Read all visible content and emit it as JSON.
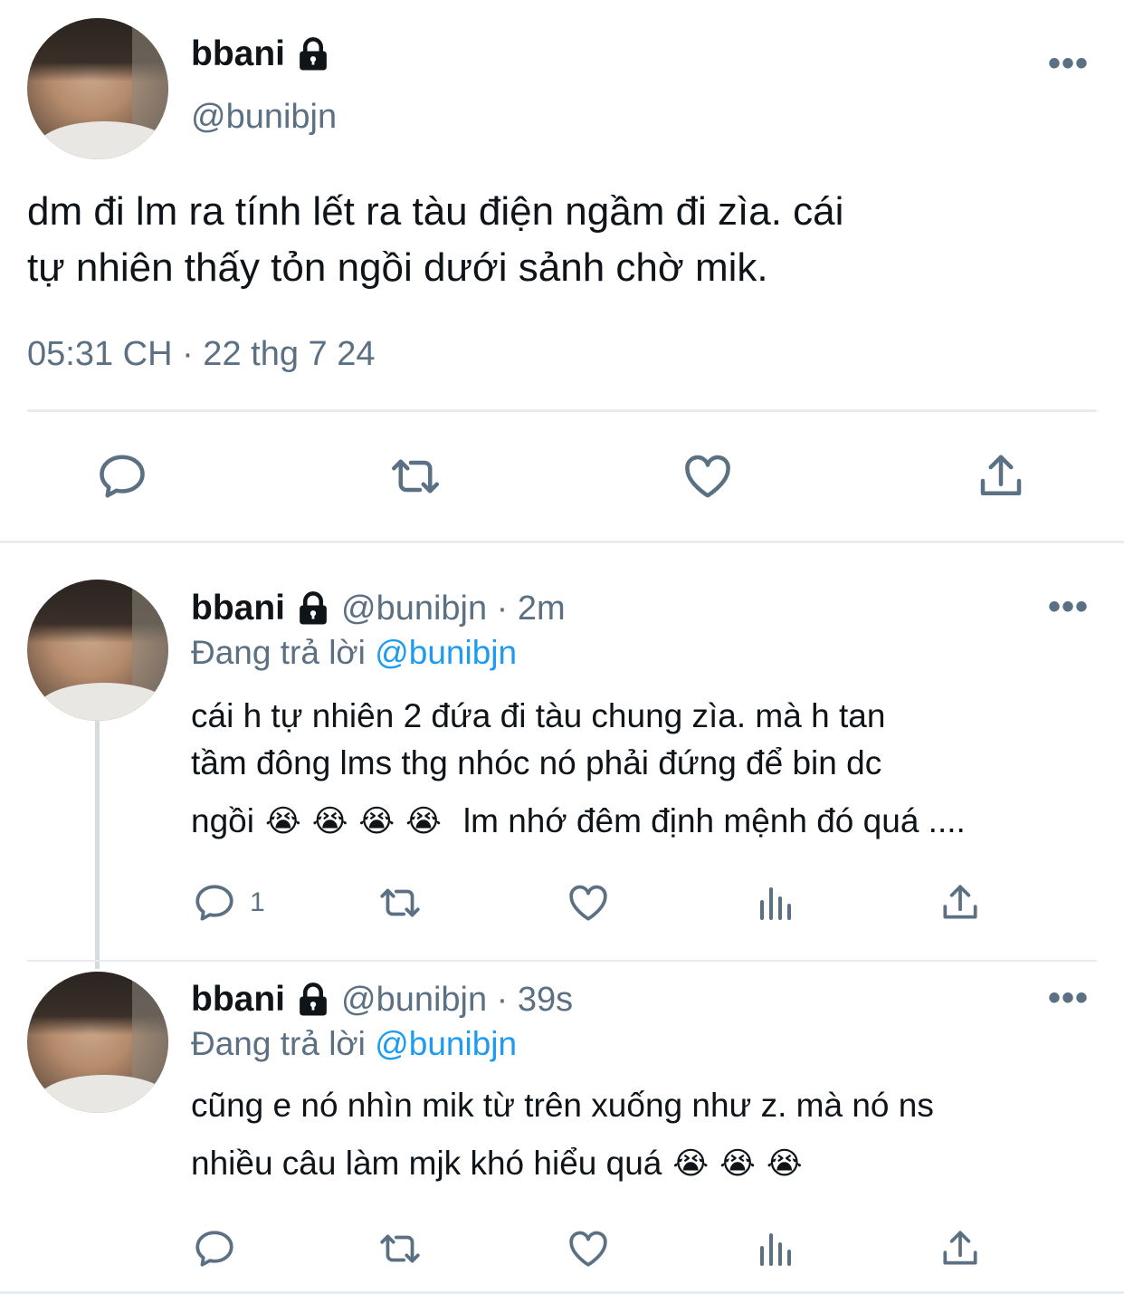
{
  "main_tweet": {
    "display_name": "bbani",
    "handle": "@bunibjn",
    "text_line1": "dm đi lm ra tính lết ra tàu điện ngầm đi zìa. cái",
    "text_line2": "tự nhiên thấy tỏn ngồi dưới sảnh chờ mik.",
    "timestamp": "05:31 CH · 22 thg 7 24",
    "more_label": "•••"
  },
  "replies": [
    {
      "display_name": "bbani",
      "handle_time": "@bunibjn · 2m",
      "replying_prefix": "Đang trả lời",
      "replying_to": "@bunibjn",
      "line1": "cái h tự nhiên 2 đứa đi tàu chung zìa. mà h tan",
      "line2": "tầm đông lms thg nhóc nó phải đứng để bin dc",
      "line3_start": "ngồi",
      "emoji": "😭",
      "line3_end": "lm nhớ đêm định mệnh đó quá ....",
      "reply_count": "1",
      "more_label": "•••"
    },
    {
      "display_name": "bbani",
      "handle_time": "@bunibjn · 39s",
      "replying_prefix": "Đang trả lời",
      "replying_to": "@bunibjn",
      "line1": "cũng e nó nhìn mik từ trên xuống như z. mà nó ns",
      "line2_start": "nhiều câu làm mjk khó hiểu quá",
      "emoji": "😭",
      "more_label": "•••"
    }
  ],
  "colors": {
    "text": "#0f1419",
    "secondary": "#5b7083",
    "accent": "#1d9bf0",
    "divider": "#e6ecf0"
  },
  "icons": [
    "lock-icon",
    "more-icon",
    "reply-icon",
    "retweet-icon",
    "like-icon",
    "share-icon",
    "analytics-icon"
  ]
}
